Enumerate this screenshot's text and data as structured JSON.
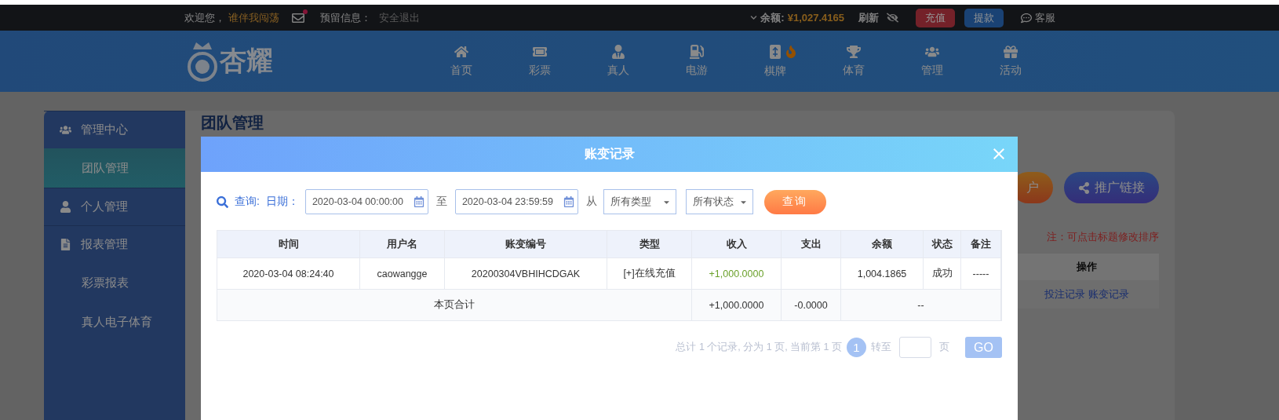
{
  "top_bar": {
    "greeting": "欢迎您，",
    "username": "谁伴我闯荡",
    "mail_unread": true,
    "reserved_info_label": "预留信息：",
    "logout": "安全退出",
    "balance_label": "余额:",
    "balance": "¥1,027.4165",
    "refresh": "刷新",
    "deposit": "充值",
    "withdraw": "提款",
    "support": "客服"
  },
  "nav": {
    "logo_text": "杏耀",
    "items": [
      {
        "label": "首页",
        "hot": false
      },
      {
        "label": "彩票",
        "hot": false
      },
      {
        "label": "真人",
        "hot": false
      },
      {
        "label": "电游",
        "hot": false
      },
      {
        "label": "棋牌",
        "hot": true
      },
      {
        "label": "体育",
        "hot": false
      },
      {
        "label": "管理",
        "hot": false
      },
      {
        "label": "活动",
        "hot": false
      }
    ]
  },
  "sidebar": {
    "groups": [
      {
        "title": "管理中心",
        "items": [
          {
            "label": "团队管理",
            "selected": true
          }
        ]
      },
      {
        "title": "个人管理"
      },
      {
        "title": "报表管理",
        "items": [
          {
            "label": "彩票报表",
            "selected": false
          },
          {
            "label": "真人电子体育",
            "selected": false
          }
        ]
      }
    ]
  },
  "main": {
    "title": "团队管理",
    "buttons": [
      {
        "label": "户",
        "kind": "open"
      },
      {
        "label": "推广链接",
        "kind": "share"
      }
    ],
    "note": "注：可点击标题修改排序",
    "table": {
      "columns": [
        "操作"
      ],
      "rows": [
        {
          "links": [
            "投注记录",
            "账变记录"
          ]
        }
      ]
    }
  },
  "modal": {
    "title": "账变记录",
    "filters": {
      "query_label": "查询:",
      "date_label": "日期：",
      "start": "2020-03-04 00:00:00",
      "to": "至",
      "end": "2020-03-04 23:59:59",
      "from": "从",
      "type_select": "所有类型",
      "status_select": "所有状态",
      "submit": "查询"
    },
    "table": {
      "columns": [
        "时间",
        "用户名",
        "账变编号",
        "类型",
        "收入",
        "支出",
        "余额",
        "状态",
        "备注"
      ],
      "rows": [
        [
          "2020-03-04 08:24:40",
          "caowangge",
          "20200304VBHIHCDGAK",
          "[+]在线充值",
          "+1,000.0000",
          "",
          "1,004.1865",
          "成功",
          "-----"
        ]
      ],
      "total": {
        "label": "本页合计",
        "income": "+1,000.0000",
        "expense": "-0.0000",
        "rest": "--"
      }
    },
    "pagination": {
      "summary": "总计 1 个记录, 分为 1 页, 当前第 1 页",
      "pages": [
        {
          "label": "1",
          "selected": true
        }
      ],
      "goto": "转至",
      "page_unit": "页",
      "go": "GO"
    }
  }
}
